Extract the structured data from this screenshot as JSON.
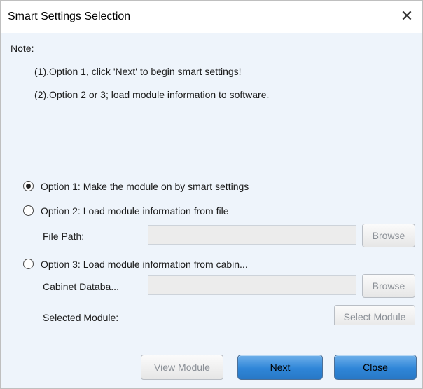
{
  "window": {
    "title": "Smart Settings Selection",
    "close_glyph": "✕"
  },
  "note": {
    "heading": "Note:",
    "line1": "(1).Option 1, click 'Next' to begin smart settings!",
    "line2": "(2).Option 2 or 3; load module information to software."
  },
  "options": {
    "option1": {
      "label": "Option 1: Make the module on by smart settings",
      "selected": true
    },
    "option2": {
      "label": "Option 2: Load module information from file",
      "selected": false
    },
    "option3": {
      "label": "Option 3: Load module information from cabin...",
      "selected": false
    }
  },
  "file_path": {
    "label": "File Path:",
    "value": "",
    "browse_label": "Browse"
  },
  "cabinet_db": {
    "label": "Cabinet Databa...",
    "value": "",
    "browse_label": "Browse"
  },
  "selected_module": {
    "label": "Selected Module:",
    "button_label": "Select Module"
  },
  "footer": {
    "view_module_label": "View Module",
    "next_label": "Next",
    "close_label": "Close"
  },
  "colors": {
    "accent": "#2f86d8",
    "panel_bg": "#eef4fb"
  }
}
